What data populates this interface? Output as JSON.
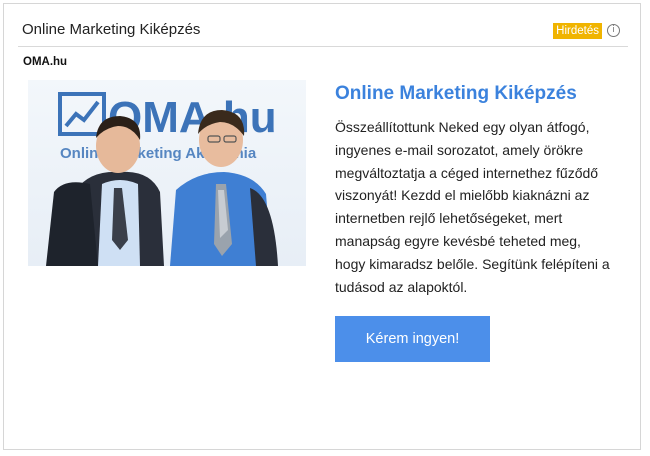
{
  "ad": {
    "title": "Online Marketing Kiképzés",
    "badge": "Hirdetés",
    "site": "OMA.hu",
    "headline": "Online Marketing Kiképzés",
    "description": "Összeállítottunk Neked egy olyan átfogó, ingyenes e-mail sorozatot, amely örökre megváltoztatja a céged internethez fűződő viszonyát! Kezdd el mielőbb kiaknázni az internetben rejlő lehetőségeket, mert manapság egyre kevésbé teheted meg, hogy kimaradsz belőle. Segítünk felépíteni a tudásod az alapoktól.",
    "cta": "Kérem ingyen!"
  },
  "photo": {
    "logo_text": "OMA.hu",
    "logo_subtext": "Online Marketing Akadémia",
    "colors": {
      "logo_blue": "#3c73b8",
      "shirt_blue": "#3f7fd3",
      "suit": "#2a2f3a"
    }
  },
  "colors": {
    "accent": "#3b82dd",
    "button": "#4c8fea",
    "badge": "#f0b400"
  }
}
